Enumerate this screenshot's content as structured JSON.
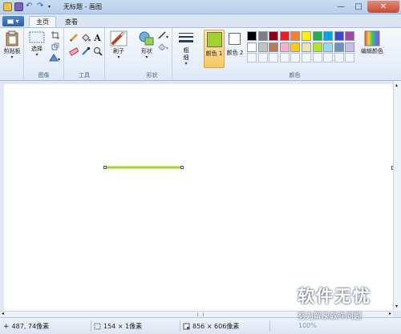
{
  "window": {
    "title": "无标题 - 画图",
    "controls": {
      "minimize": "—",
      "maximize": "□",
      "close": "✕"
    }
  },
  "tabs": {
    "home": "主页",
    "view": "查看"
  },
  "ribbon": {
    "clipboard": {
      "paste": "剪贴板"
    },
    "image": {
      "select": "选择",
      "group": "图像"
    },
    "tools": {
      "group": "工具",
      "text": "A"
    },
    "brush": {
      "label": "刷子"
    },
    "shapes": {
      "label": "形状",
      "group": "形状"
    },
    "size": {
      "label": "粗细"
    },
    "colors": {
      "color1": "颜色 1",
      "color2": "颜色 2",
      "edit": "编辑颜色",
      "group": "颜色",
      "color1_value": "#a3d12e",
      "color2_value": "#ffffff",
      "palette_row1": [
        "#000000",
        "#7f7f7f",
        "#880015",
        "#ed1c24",
        "#ff7f27",
        "#fff200",
        "#22b14c",
        "#00a2e8",
        "#3f48cc",
        "#a349a4"
      ],
      "palette_row2": [
        "#ffffff",
        "#c3c3c3",
        "#b97a57",
        "#ffaec9",
        "#ffc90e",
        "#efe4b0",
        "#b5e61d",
        "#99d9ea",
        "#7092be",
        "#c8bfe7"
      ]
    }
  },
  "canvas": {
    "line_color": "#a3d12e"
  },
  "status": {
    "cursor": "487, 74像素",
    "selection": "154 × 1像素",
    "canvas_size": "856 × 606像素",
    "zoom": "100%"
  },
  "watermark": {
    "brand": "软件无忧",
    "tagline": "努力解决软件问题"
  }
}
